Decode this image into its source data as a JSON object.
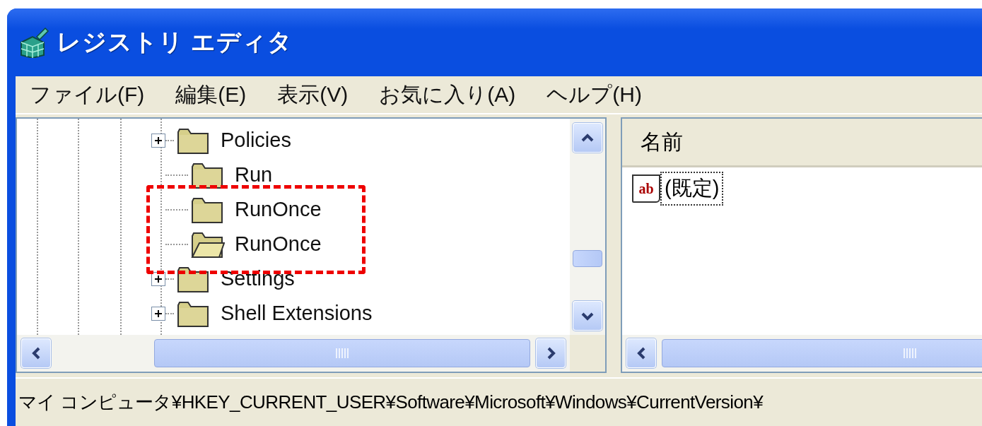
{
  "window": {
    "title": "レジストリ エディタ"
  },
  "menu": [
    {
      "label": "ファイル(F)"
    },
    {
      "label": "編集(E)"
    },
    {
      "label": "表示(V)"
    },
    {
      "label": "お気に入り(A)"
    },
    {
      "label": "ヘルプ(H)"
    }
  ],
  "tree": {
    "items": [
      {
        "label": "Policies",
        "expandable": true,
        "open": false
      },
      {
        "label": "Run",
        "expandable": false,
        "open": false
      },
      {
        "label": "RunOnce",
        "expandable": false,
        "open": false
      },
      {
        "label": "RunOnce",
        "expandable": false,
        "open": true
      },
      {
        "label": "Settings",
        "expandable": true,
        "open": false
      },
      {
        "label": "Shell Extensions",
        "expandable": true,
        "open": false
      }
    ]
  },
  "values": {
    "columns": [
      "名前"
    ],
    "rows": [
      {
        "icon": "ab",
        "name": "(既定)",
        "selected": true
      }
    ]
  },
  "status_bar": "マイ コンピュータ¥HKEY_CURRENT_USER¥Software¥Microsoft¥Windows¥CurrentVersion¥"
}
